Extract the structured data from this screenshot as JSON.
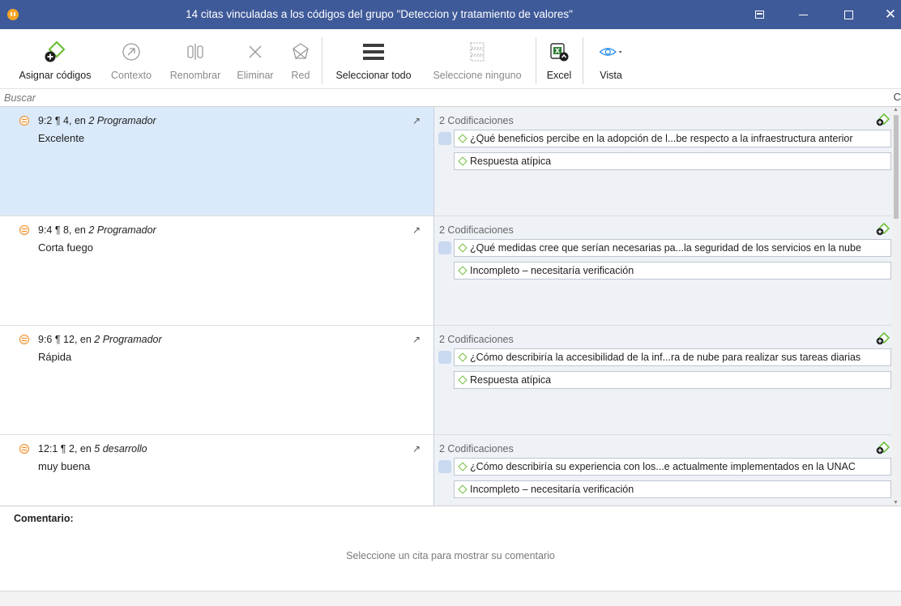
{
  "window": {
    "title": "14 citas vinculadas a los códigos del grupo \"Deteccion y tratamiento de valores\"",
    "close_glyph": "✕"
  },
  "ribbon": {
    "assign_label": "Asignar códigos",
    "context_label": "Contexto",
    "rename_label": "Renombrar",
    "delete_label": "Eliminar",
    "network_label": "Red",
    "select_all_label": "Seleccionar todo",
    "select_none_label": "Seleccione ninguno",
    "excel_label": "Excel",
    "view_label": "Vista"
  },
  "search": {
    "placeholder": "Buscar"
  },
  "rows": [
    {
      "id": "9:2 ¶ 4,",
      "location_prefix": "en",
      "document": "2 Programador",
      "text": "Excelente",
      "codings_title": "2 Codificaciones",
      "codes": [
        "¿Qué beneficios percibe en la adopción de l...be respecto a la infraestructura anterior",
        "Respuesta atípica"
      ]
    },
    {
      "id": "9:4 ¶ 8,",
      "location_prefix": "en",
      "document": "2 Programador",
      "text": "Corta fuego",
      "codings_title": "2 Codificaciones",
      "codes": [
        "¿Qué medidas cree que serían necesarias pa...la seguridad de los servicios en la nube",
        "Incompleto – necesitaría verificación"
      ]
    },
    {
      "id": "9:6 ¶ 12,",
      "location_prefix": "en",
      "document": "2 Programador",
      "text": "Rápida",
      "codings_title": "2 Codificaciones",
      "codes": [
        "¿Cómo describiría la accesibilidad de la inf...ra de nube para realizar sus tareas diarias",
        "Respuesta atípica"
      ]
    },
    {
      "id": "12:1 ¶ 2,",
      "location_prefix": "en",
      "document": "5 desarrollo",
      "text": "muy buena",
      "codings_title": "2 Codificaciones",
      "codes": [
        "¿Cómo describiría su experiencia con los...e actualmente implementados en la UNAC",
        "Incompleto – necesitaría verificación"
      ]
    }
  ],
  "comment": {
    "heading": "Comentario:",
    "hint": "Seleccione un cita para mostrar su comentario"
  }
}
